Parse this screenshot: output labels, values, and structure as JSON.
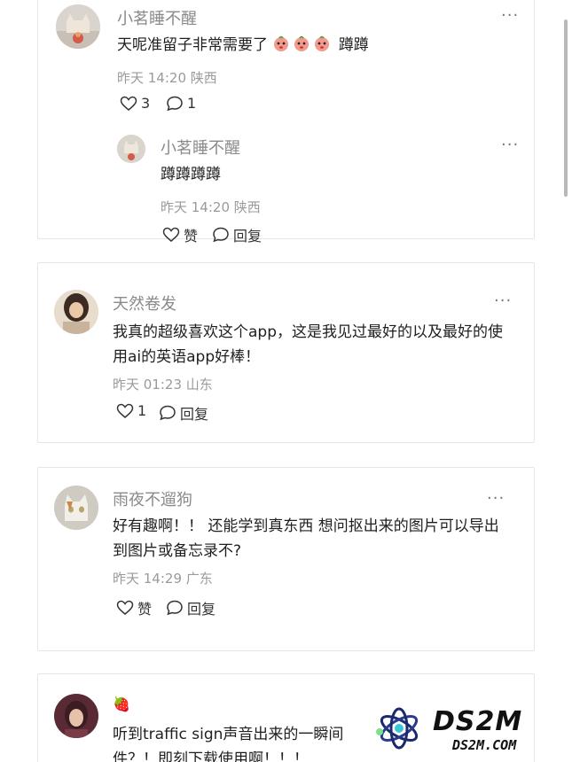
{
  "comments": [
    {
      "username": "小茗睡不醒",
      "text_before": "天呢准留子非常需要了",
      "emoji_count": 3,
      "text_after": "蹲蹲",
      "time": "昨天 14:20",
      "location": "陕西",
      "like_count": "3",
      "reply_count": "1",
      "reply": {
        "username": "小茗睡不醒",
        "text": "蹲蹲蹲蹲",
        "time": "昨天 14:20",
        "location": "陕西",
        "like_label": "赞",
        "reply_label": "回复"
      }
    },
    {
      "username": "天然卷发",
      "text": "我真的超级喜欢这个app，这是我见过最好的以及最好的使用ai的英语app好棒！",
      "time": "昨天 01:23",
      "location": "山东",
      "like_count": "1",
      "reply_label": "回复"
    },
    {
      "username": "雨夜不遛狗",
      "text": "好有趣啊！！ 还能学到真东西 想问抠出来的图片可以导出到图片或备忘录不?",
      "time": "昨天 14:29",
      "location": "广东",
      "like_label": "赞",
      "reply_label": "回复"
    },
    {
      "username": "🍓",
      "text": "听到traffic sign声音出来的一瞬间件？！即刻下载使用啊！！！"
    }
  ],
  "more_symbol": "···",
  "watermark": {
    "brand": "DS2M",
    "domain": "DS2M.COM"
  },
  "colors": {
    "name": "#8a8a8a",
    "meta": "#9a9a9a",
    "text": "#1f1f1f",
    "border": "#e6e6e6"
  }
}
